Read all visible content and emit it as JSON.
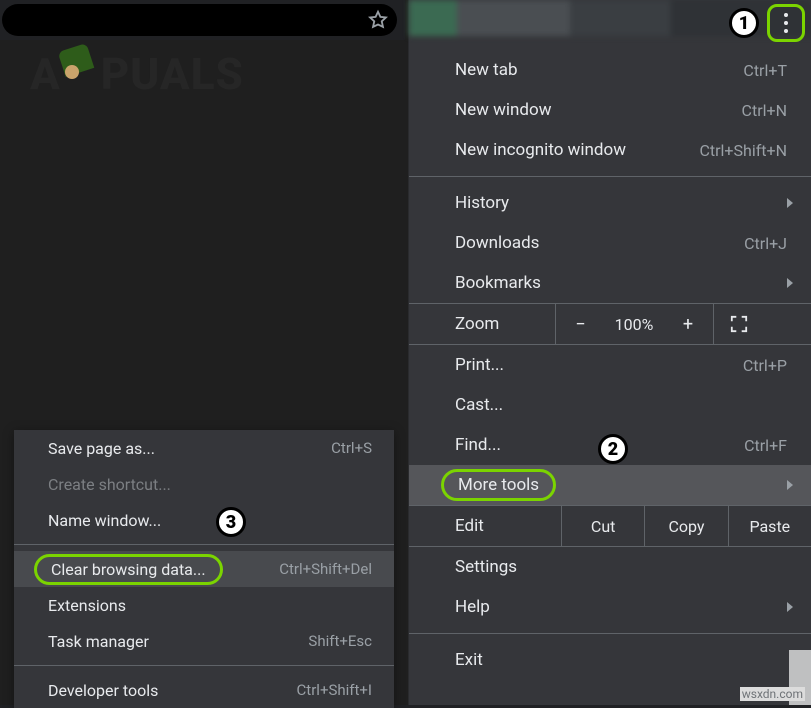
{
  "watermark": "wsxdn.com",
  "address": {
    "star_tooltip": "Bookmark this tab"
  },
  "logo_text_a": "A",
  "logo_text_rest": "PUALS",
  "badges": {
    "one": "1",
    "two": "2",
    "three": "3"
  },
  "menu": {
    "new_tab": {
      "label": "New tab",
      "shortcut": "Ctrl+T"
    },
    "new_window": {
      "label": "New window",
      "shortcut": "Ctrl+N"
    },
    "new_incognito": {
      "label": "New incognito window",
      "shortcut": "Ctrl+Shift+N"
    },
    "history": {
      "label": "History"
    },
    "downloads": {
      "label": "Downloads",
      "shortcut": "Ctrl+J"
    },
    "bookmarks": {
      "label": "Bookmarks"
    },
    "zoom": {
      "label": "Zoom",
      "minus": "−",
      "pct": "100%",
      "plus": "+"
    },
    "print": {
      "label": "Print...",
      "shortcut": "Ctrl+P"
    },
    "cast": {
      "label": "Cast..."
    },
    "find": {
      "label": "Find...",
      "shortcut": "Ctrl+F"
    },
    "more_tools": {
      "label": "More tools"
    },
    "edit": {
      "label": "Edit",
      "cut": "Cut",
      "copy": "Copy",
      "paste": "Paste"
    },
    "settings": {
      "label": "Settings"
    },
    "help": {
      "label": "Help"
    },
    "exit": {
      "label": "Exit"
    }
  },
  "submenu": {
    "save_page": {
      "label": "Save page as...",
      "shortcut": "Ctrl+S"
    },
    "create_shortcut": {
      "label": "Create shortcut..."
    },
    "name_window": {
      "label": "Name window..."
    },
    "clear_browsing": {
      "label": "Clear browsing data...",
      "shortcut": "Ctrl+Shift+Del"
    },
    "extensions": {
      "label": "Extensions"
    },
    "task_manager": {
      "label": "Task manager",
      "shortcut": "Shift+Esc"
    },
    "dev_tools": {
      "label": "Developer tools",
      "shortcut": "Ctrl+Shift+I"
    }
  }
}
